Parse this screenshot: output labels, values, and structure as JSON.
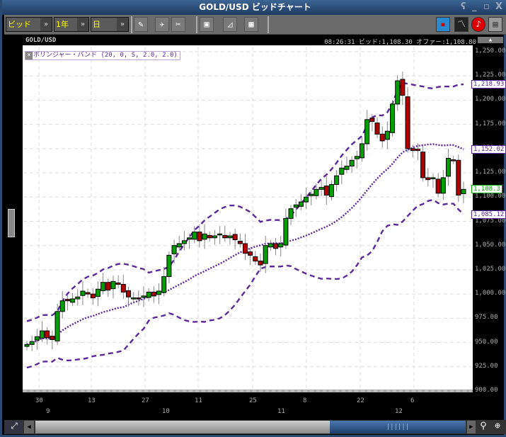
{
  "window": {
    "title": "GOLD/USD ビッドチャート",
    "min": "_",
    "restore": "▫",
    "close": "X",
    "pin": "ʕ"
  },
  "toolbar": {
    "price_type": "ビッド",
    "period": "1年",
    "interval": "日"
  },
  "header": {
    "symbol": "GOLD/USD",
    "time": "08:26:31",
    "bid_label": "ビッド:1,108.30",
    "offer_label": "オファー:1,108.80"
  },
  "legend": {
    "close_icon": "×",
    "label": "ボリンジャー・バンド (20, 0, S, 2.0, 2.0)"
  },
  "badges": {
    "upper": "1,218.93",
    "middle": "1,152.02",
    "last": "1,108.3",
    "lower": "1,085.12"
  },
  "colors": {
    "up": "#00a000",
    "down": "#b00000",
    "band": "#5a2a9a"
  },
  "chart_data": {
    "type": "candlestick",
    "title": "GOLD/USD",
    "ylim": [
      900,
      1250
    ],
    "y_ticks": [
      "1,250.00",
      "1,225.00",
      "1,200.00",
      "1,175.00",
      "1,150.00",
      "1,125.00",
      "1,100.00",
      "1,075.00",
      "1,050.00",
      "1,025.00",
      "1,000.00",
      "975.00",
      "950.00",
      "925.00",
      "900.00"
    ],
    "x_day_labels": [
      "30",
      "13",
      "27",
      "11",
      "25",
      "8",
      "22",
      "6"
    ],
    "x_month_labels": [
      "9",
      "10",
      "11",
      "12"
    ],
    "closes": [
      948,
      951,
      956,
      962,
      955,
      953,
      982,
      993,
      993,
      995,
      997,
      1003,
      1000,
      996,
      1005,
      1012,
      1004,
      1013,
      1010,
      1002,
      997,
      996,
      995,
      998,
      1002,
      998,
      1003,
      1018,
      1040,
      1050,
      1052,
      1055,
      1058,
      1064,
      1055,
      1062,
      1058,
      1060,
      1062,
      1058,
      1060,
      1056,
      1052,
      1042,
      1040,
      1034,
      1030,
      1050,
      1052,
      1047,
      1052,
      1078,
      1088,
      1092,
      1095,
      1100,
      1103,
      1108,
      1110,
      1102,
      1113,
      1122,
      1130,
      1132,
      1138,
      1142,
      1155,
      1180,
      1178,
      1165,
      1158,
      1168,
      1196,
      1220,
      1205,
      1150,
      1148,
      1148,
      1120,
      1118,
      1120,
      1104,
      1120,
      1140,
      1138,
      1102,
      1108
    ],
    "indicator": "Bollinger Bands (20, 2.0)"
  }
}
